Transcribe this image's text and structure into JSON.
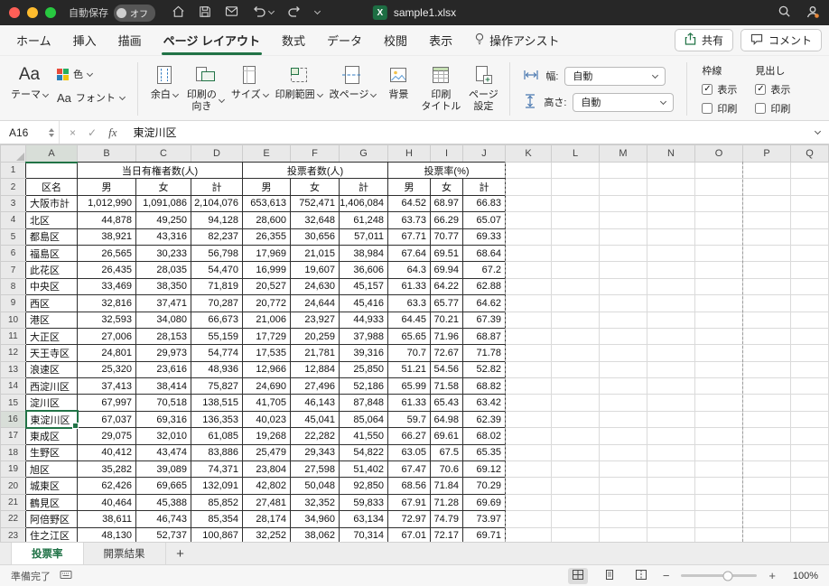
{
  "colors": {
    "accent_green": "#217346",
    "titlebar": "#272727"
  },
  "titlebar": {
    "autosave_label": "自動保存",
    "autosave_state": "オフ",
    "filename": "sample1.xlsx"
  },
  "ribbon_tabs": {
    "tabs": [
      {
        "id": "home",
        "label": "ホーム",
        "active": false
      },
      {
        "id": "insert",
        "label": "挿入",
        "active": false
      },
      {
        "id": "draw",
        "label": "描画",
        "active": false
      },
      {
        "id": "page-layout",
        "label": "ページ レイアウト",
        "active": true
      },
      {
        "id": "formulas",
        "label": "数式",
        "active": false
      },
      {
        "id": "data",
        "label": "データ",
        "active": false
      },
      {
        "id": "review",
        "label": "校閲",
        "active": false
      },
      {
        "id": "view",
        "label": "表示",
        "active": false
      },
      {
        "id": "tell-me",
        "label": "操作アシスト",
        "active": false,
        "icon": "lightbulb-icon"
      }
    ],
    "share_label": "共有",
    "comments_label": "コメント"
  },
  "ribbon": {
    "themes_group": {
      "themes_label": "テーマ",
      "themes_icon_text": "Aa",
      "colors_label": "色",
      "fonts_label": "フォント",
      "fonts_icon_text": "Aa"
    },
    "page_setup_buttons": [
      {
        "id": "margins",
        "label": "余白",
        "icon": "margins-icon",
        "dropdown": true
      },
      {
        "id": "orientation",
        "label": "印刷の\n向き",
        "icon": "orientation-icon",
        "dropdown": true
      },
      {
        "id": "size",
        "label": "サイズ",
        "icon": "size-icon",
        "dropdown": true
      },
      {
        "id": "print-area",
        "label": "印刷範囲",
        "icon": "print-area-icon",
        "dropdown": true
      },
      {
        "id": "breaks",
        "label": "改ページ",
        "icon": "breaks-icon",
        "dropdown": true
      },
      {
        "id": "background",
        "label": "背景",
        "icon": "background-icon",
        "dropdown": false
      },
      {
        "id": "print-titles",
        "label": "印刷\nタイトル",
        "icon": "print-titles-icon",
        "dropdown": false
      },
      {
        "id": "page-setup",
        "label": "ページ\n設定",
        "icon": "page-setup-icon",
        "dropdown": false
      }
    ],
    "scale_group": {
      "width_label": "幅:",
      "width_value": "自動",
      "height_label": "高さ:",
      "height_value": "自動"
    },
    "sheet_options": {
      "gridlines_label": "枠線",
      "headings_label": "見出し",
      "view_label": "表示",
      "print_label": "印刷",
      "gridlines_view": true,
      "gridlines_print": false,
      "headings_view": true,
      "headings_print": false
    }
  },
  "formula_bar": {
    "name_box": "A16",
    "fx_label": "fx",
    "cancel_label": "×",
    "enter_label": "✓",
    "content": "東淀川区"
  },
  "grid": {
    "selected_cell": "A16",
    "column_letters": [
      "A",
      "B",
      "C",
      "D",
      "E",
      "F",
      "G",
      "H",
      "I",
      "J",
      "K",
      "L",
      "M",
      "N",
      "O",
      "P",
      "Q"
    ],
    "group_headers": [
      {
        "label": "当日有権者数(人)",
        "span": 3
      },
      {
        "label": "投票者数(人)",
        "span": 3
      },
      {
        "label": "投票率(%)",
        "span": 3
      }
    ],
    "sub_headers": [
      "区名",
      "男",
      "女",
      "計",
      "男",
      "女",
      "計",
      "男",
      "女",
      "計"
    ],
    "rows": [
      {
        "name": "大阪市計",
        "values": [
          "1,012,990",
          "1,091,086",
          "2,104,076",
          "653,613",
          "752,471",
          "1,406,084",
          "64.52",
          "68.97",
          "66.83"
        ]
      },
      {
        "name": "北区",
        "values": [
          "44,878",
          "49,250",
          "94,128",
          "28,600",
          "32,648",
          "61,248",
          "63.73",
          "66.29",
          "65.07"
        ]
      },
      {
        "name": "都島区",
        "values": [
          "38,921",
          "43,316",
          "82,237",
          "26,355",
          "30,656",
          "57,011",
          "67.71",
          "70.77",
          "69.33"
        ]
      },
      {
        "name": "福島区",
        "values": [
          "26,565",
          "30,233",
          "56,798",
          "17,969",
          "21,015",
          "38,984",
          "67.64",
          "69.51",
          "68.64"
        ]
      },
      {
        "name": "此花区",
        "values": [
          "26,435",
          "28,035",
          "54,470",
          "16,999",
          "19,607",
          "36,606",
          "64.3",
          "69.94",
          "67.2"
        ]
      },
      {
        "name": "中央区",
        "values": [
          "33,469",
          "38,350",
          "71,819",
          "20,527",
          "24,630",
          "45,157",
          "61.33",
          "64.22",
          "62.88"
        ]
      },
      {
        "name": "西区",
        "values": [
          "32,816",
          "37,471",
          "70,287",
          "20,772",
          "24,644",
          "45,416",
          "63.3",
          "65.77",
          "64.62"
        ]
      },
      {
        "name": "港区",
        "values": [
          "32,593",
          "34,080",
          "66,673",
          "21,006",
          "23,927",
          "44,933",
          "64.45",
          "70.21",
          "67.39"
        ]
      },
      {
        "name": "大正区",
        "values": [
          "27,006",
          "28,153",
          "55,159",
          "17,729",
          "20,259",
          "37,988",
          "65.65",
          "71.96",
          "68.87"
        ]
      },
      {
        "name": "天王寺区",
        "values": [
          "24,801",
          "29,973",
          "54,774",
          "17,535",
          "21,781",
          "39,316",
          "70.7",
          "72.67",
          "71.78"
        ]
      },
      {
        "name": "浪速区",
        "values": [
          "25,320",
          "23,616",
          "48,936",
          "12,966",
          "12,884",
          "25,850",
          "51.21",
          "54.56",
          "52.82"
        ]
      },
      {
        "name": "西淀川区",
        "values": [
          "37,413",
          "38,414",
          "75,827",
          "24,690",
          "27,496",
          "52,186",
          "65.99",
          "71.58",
          "68.82"
        ]
      },
      {
        "name": "淀川区",
        "values": [
          "67,997",
          "70,518",
          "138,515",
          "41,705",
          "46,143",
          "87,848",
          "61.33",
          "65.43",
          "63.42"
        ]
      },
      {
        "name": "東淀川区",
        "values": [
          "67,037",
          "69,316",
          "136,353",
          "40,023",
          "45,041",
          "85,064",
          "59.7",
          "64.98",
          "62.39"
        ],
        "selected": true
      },
      {
        "name": "東成区",
        "values": [
          "29,075",
          "32,010",
          "61,085",
          "19,268",
          "22,282",
          "41,550",
          "66.27",
          "69.61",
          "68.02"
        ]
      },
      {
        "name": "生野区",
        "values": [
          "40,412",
          "43,474",
          "83,886",
          "25,479",
          "29,343",
          "54,822",
          "63.05",
          "67.5",
          "65.35"
        ]
      },
      {
        "name": "旭区",
        "values": [
          "35,282",
          "39,089",
          "74,371",
          "23,804",
          "27,598",
          "51,402",
          "67.47",
          "70.6",
          "69.12"
        ]
      },
      {
        "name": "城東区",
        "values": [
          "62,426",
          "69,665",
          "132,091",
          "42,802",
          "50,048",
          "92,850",
          "68.56",
          "71.84",
          "70.29"
        ]
      },
      {
        "name": "鶴見区",
        "values": [
          "40,464",
          "45,388",
          "85,852",
          "27,481",
          "32,352",
          "59,833",
          "67.91",
          "71.28",
          "69.69"
        ]
      },
      {
        "name": "阿倍野区",
        "values": [
          "38,611",
          "46,743",
          "85,354",
          "28,174",
          "34,960",
          "63,134",
          "72.97",
          "74.79",
          "73.97"
        ]
      },
      {
        "name": "住之江区",
        "values": [
          "48,130",
          "52,737",
          "100,867",
          "32,252",
          "38,062",
          "70,314",
          "67.01",
          "72.17",
          "69.71"
        ]
      }
    ]
  },
  "sheet_tabs": [
    {
      "id": "turnout",
      "label": "投票率",
      "active": true
    },
    {
      "id": "results",
      "label": "開票結果",
      "active": false
    }
  ],
  "status_bar": {
    "ready_label": "準備完了",
    "zoom_label": "100%"
  }
}
